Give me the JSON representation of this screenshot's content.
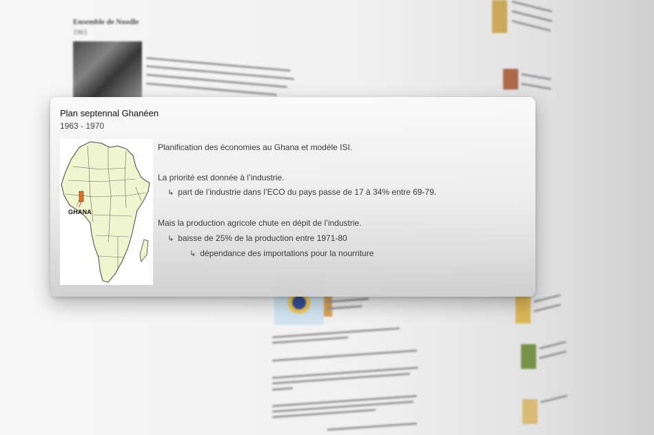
{
  "background": {
    "doc_title": "Ensemble de Noodle",
    "doc_subtitle": "1963"
  },
  "card": {
    "title": "Plan septennal Ghanéen",
    "date_range": "1963 - 1970",
    "map": {
      "label": "GHANA",
      "fill_color": "#eef5cf",
      "highlight_color": "#e8701f",
      "icon": "africa-map"
    },
    "lines": [
      {
        "indent": 0,
        "arrow": false,
        "text": "Planification des économies au Ghana et modèle ISI."
      },
      {
        "indent": 0,
        "arrow": false,
        "text": "La priorité est donnée à l’industrie."
      },
      {
        "indent": 1,
        "arrow": true,
        "text": "part de l’industrie dans l’ECO du pays passe de 17 à 34% entre 69-79."
      },
      {
        "indent": 0,
        "arrow": false,
        "text": "Mais la production agricole chute en dépit de l’industrie."
      },
      {
        "indent": 1,
        "arrow": true,
        "text": "baisse de 25% de la production entre 1971-80"
      },
      {
        "indent": 2,
        "arrow": true,
        "text": "dépendance des importations pour la nourriture"
      }
    ],
    "arrow_glyph": "↳"
  }
}
